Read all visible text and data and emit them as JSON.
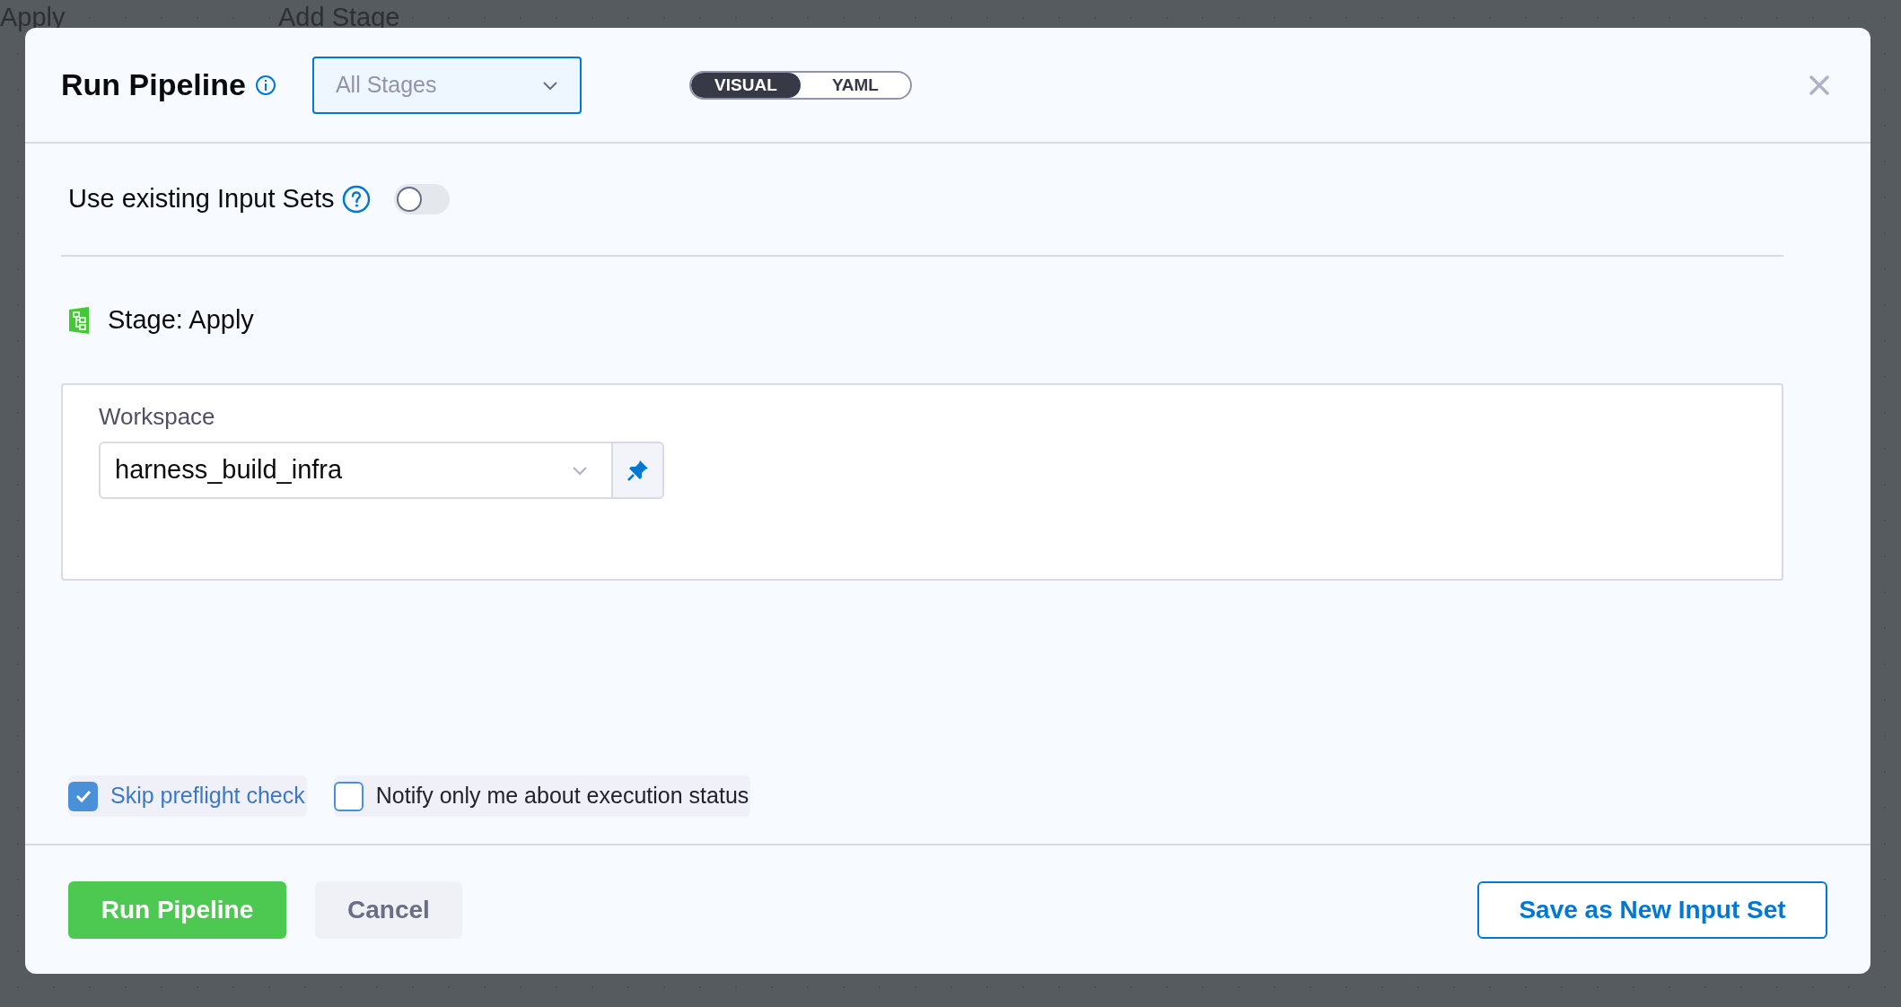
{
  "background": {
    "labels": [
      "Apply",
      "Add Stage"
    ]
  },
  "dialog": {
    "title": "Run Pipeline",
    "stage_select": {
      "value": "All Stages"
    },
    "view_toggle": [
      {
        "label": "VISUAL",
        "selected": true
      },
      {
        "label": "YAML",
        "selected": false
      }
    ],
    "input_sets": {
      "label": "Use existing Input Sets",
      "on": false
    },
    "stage": {
      "title": "Stage: Apply",
      "fields": [
        {
          "label": "Workspace",
          "value": "harness_build_infra"
        }
      ]
    },
    "options": [
      {
        "label": "Skip preflight check",
        "checked": true
      },
      {
        "label": "Notify only me about execution status",
        "checked": false
      }
    ],
    "footer": {
      "primary": "Run Pipeline",
      "cancel": "Cancel",
      "save": "Save as New Input Set"
    }
  }
}
